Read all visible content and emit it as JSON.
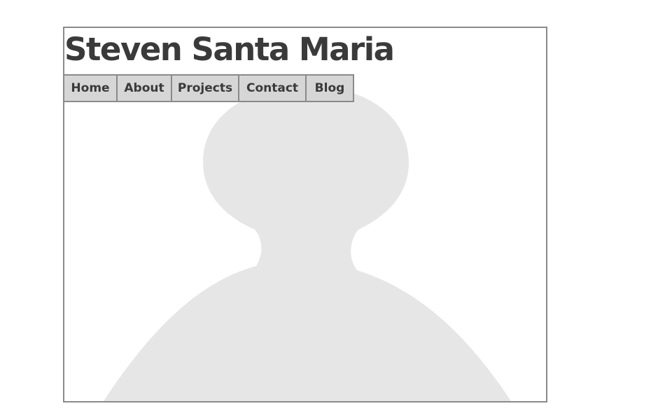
{
  "site": {
    "title": "Steven Santa Maria"
  },
  "nav": {
    "items": [
      {
        "label": "Home"
      },
      {
        "label": "About"
      },
      {
        "label": "Projects"
      },
      {
        "label": "Contact"
      },
      {
        "label": "Blog"
      }
    ]
  },
  "hero": {
    "image_icon": "person-silhouette-icon",
    "silhouette_color": "#e6e6e6"
  },
  "colors": {
    "text": "#3a3a3a",
    "border": "#8a8a8a",
    "nav_bg": "#d6d6d6"
  }
}
